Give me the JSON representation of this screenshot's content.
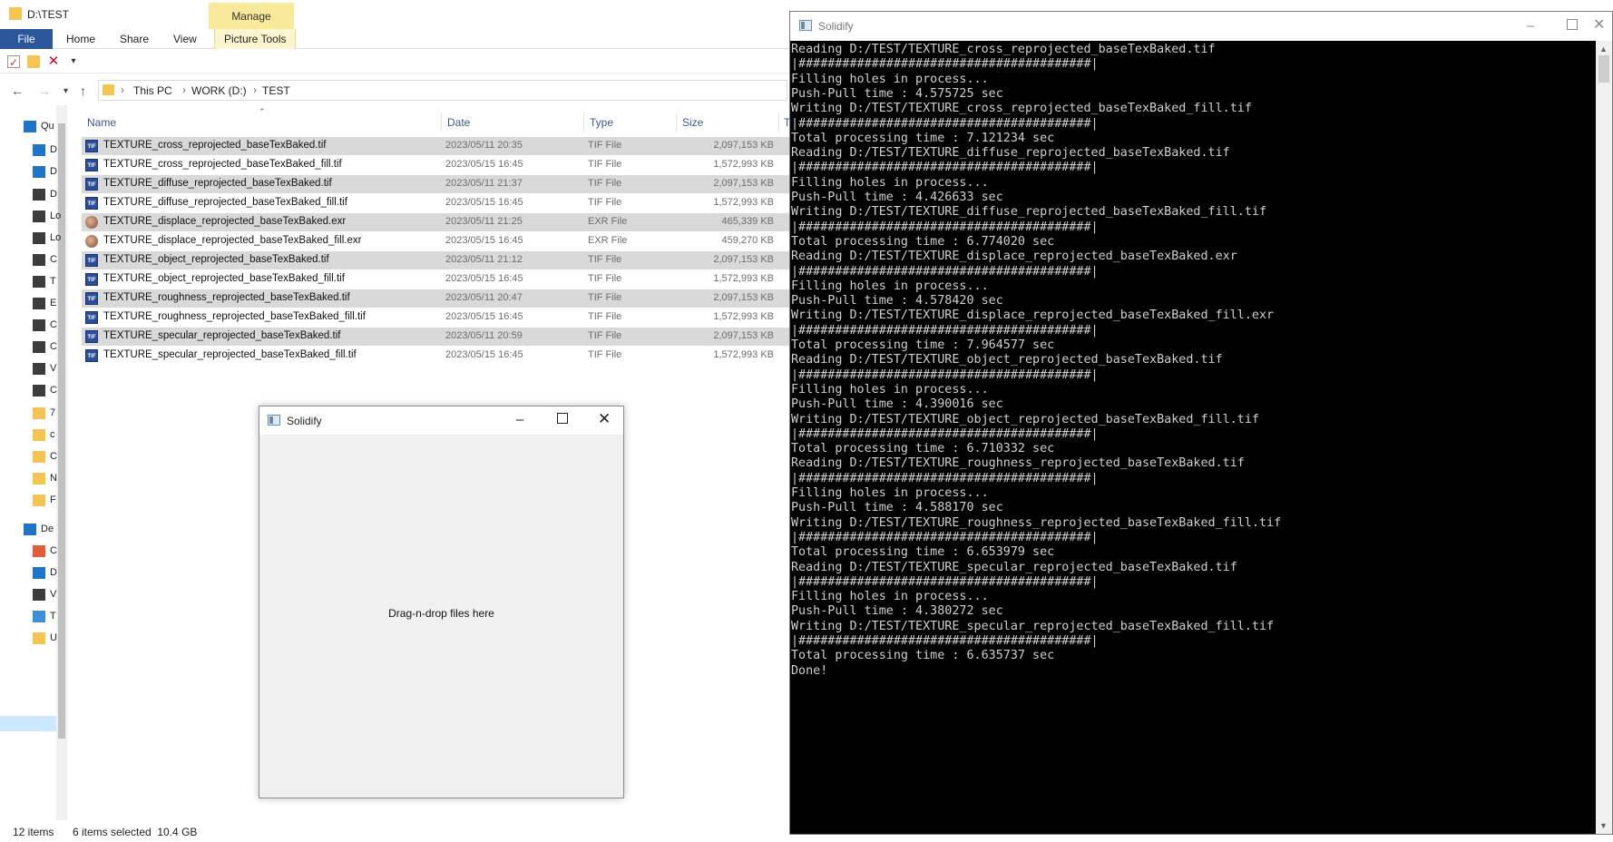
{
  "explorer": {
    "title": "D:\\TEST",
    "ribbon": {
      "contextual_group": "Manage",
      "tabs": [
        "File",
        "Home",
        "Share",
        "View",
        "Picture Tools"
      ]
    },
    "address": {
      "crumbs": [
        "This PC",
        "WORK (D:)",
        "TEST"
      ]
    },
    "sidebar_labels": [
      "Qu",
      "D",
      "D",
      "D",
      "Lo",
      "Lo",
      "C",
      "T",
      "E",
      "C",
      "C",
      "V",
      "C",
      "7",
      "c",
      "C",
      "N",
      "F",
      "De",
      "C",
      "D",
      "V",
      "T",
      "U"
    ],
    "columns": {
      "name": "Name",
      "date": "Date",
      "type": "Type",
      "size": "Size",
      "tags": "T"
    },
    "files": [
      {
        "name": "TEXTURE_cross_reprojected_baseTexBaked.tif",
        "date": "2023/05/11 20:35",
        "type": "TIF File",
        "size": "2,097,153 KB",
        "kind": "tif",
        "selected": true
      },
      {
        "name": "TEXTURE_cross_reprojected_baseTexBaked_fill.tif",
        "date": "2023/05/15 16:45",
        "type": "TIF File",
        "size": "1,572,993 KB",
        "kind": "tif",
        "selected": false
      },
      {
        "name": "TEXTURE_diffuse_reprojected_baseTexBaked.tif",
        "date": "2023/05/11 21:37",
        "type": "TIF File",
        "size": "2,097,153 KB",
        "kind": "tif",
        "selected": true
      },
      {
        "name": "TEXTURE_diffuse_reprojected_baseTexBaked_fill.tif",
        "date": "2023/05/15 16:45",
        "type": "TIF File",
        "size": "1,572,993 KB",
        "kind": "tif",
        "selected": false
      },
      {
        "name": "TEXTURE_displace_reprojected_baseTexBaked.exr",
        "date": "2023/05/11 21:25",
        "type": "EXR File",
        "size": "465,339 KB",
        "kind": "exr",
        "selected": true
      },
      {
        "name": "TEXTURE_displace_reprojected_baseTexBaked_fill.exr",
        "date": "2023/05/15 16:45",
        "type": "EXR File",
        "size": "459,270 KB",
        "kind": "exr",
        "selected": false
      },
      {
        "name": "TEXTURE_object_reprojected_baseTexBaked.tif",
        "date": "2023/05/11 21:12",
        "type": "TIF File",
        "size": "2,097,153 KB",
        "kind": "tif",
        "selected": true
      },
      {
        "name": "TEXTURE_object_reprojected_baseTexBaked_fill.tif",
        "date": "2023/05/15 16:45",
        "type": "TIF File",
        "size": "1,572,993 KB",
        "kind": "tif",
        "selected": false
      },
      {
        "name": "TEXTURE_roughness_reprojected_baseTexBaked.tif",
        "date": "2023/05/11 20:47",
        "type": "TIF File",
        "size": "2,097,153 KB",
        "kind": "tif",
        "selected": true
      },
      {
        "name": "TEXTURE_roughness_reprojected_baseTexBaked_fill.tif",
        "date": "2023/05/15 16:45",
        "type": "TIF File",
        "size": "1,572,993 KB",
        "kind": "tif",
        "selected": false
      },
      {
        "name": "TEXTURE_specular_reprojected_baseTexBaked.tif",
        "date": "2023/05/11 20:59",
        "type": "TIF File",
        "size": "2,097,153 KB",
        "kind": "tif",
        "selected": true
      },
      {
        "name": "TEXTURE_specular_reprojected_baseTexBaked_fill.tif",
        "date": "2023/05/15 16:45",
        "type": "TIF File",
        "size": "1,572,993 KB",
        "kind": "tif",
        "selected": false
      }
    ],
    "status": {
      "items": "12 items",
      "selected": "6 items selected  10.4 GB"
    }
  },
  "drop_window": {
    "title": "Solidify",
    "drop_text": "Drag-n-drop files here"
  },
  "console": {
    "title": "Solidify",
    "lines": [
      "Reading D:/TEST/TEXTURE_cross_reprojected_baseTexBaked.tif",
      "|########################################|",
      "Filling holes in process...",
      "Push-Pull time : 4.575725 sec",
      "Writing D:/TEST/TEXTURE_cross_reprojected_baseTexBaked_fill.tif",
      "|########################################|",
      "Total processing time : 7.121234 sec",
      "Reading D:/TEST/TEXTURE_diffuse_reprojected_baseTexBaked.tif",
      "|########################################|",
      "Filling holes in process...",
      "Push-Pull time : 4.426633 sec",
      "Writing D:/TEST/TEXTURE_diffuse_reprojected_baseTexBaked_fill.tif",
      "|########################################|",
      "Total processing time : 6.774020 sec",
      "Reading D:/TEST/TEXTURE_displace_reprojected_baseTexBaked.exr",
      "|########################################|",
      "Filling holes in process...",
      "Push-Pull time : 4.578420 sec",
      "Writing D:/TEST/TEXTURE_displace_reprojected_baseTexBaked_fill.exr",
      "|########################################|",
      "Total processing time : 7.964577 sec",
      "Reading D:/TEST/TEXTURE_object_reprojected_baseTexBaked.tif",
      "|########################################|",
      "Filling holes in process...",
      "Push-Pull time : 4.390016 sec",
      "Writing D:/TEST/TEXTURE_object_reprojected_baseTexBaked_fill.tif",
      "|########################################|",
      "Total processing time : 6.710332 sec",
      "Reading D:/TEST/TEXTURE_roughness_reprojected_baseTexBaked.tif",
      "|########################################|",
      "Filling holes in process...",
      "Push-Pull time : 4.588170 sec",
      "Writing D:/TEST/TEXTURE_roughness_reprojected_baseTexBaked_fill.tif",
      "|########################################|",
      "Total processing time : 6.653979 sec",
      "Reading D:/TEST/TEXTURE_specular_reprojected_baseTexBaked.tif",
      "|########################################|",
      "Filling holes in process...",
      "Push-Pull time : 4.380272 sec",
      "Writing D:/TEST/TEXTURE_specular_reprojected_baseTexBaked_fill.tif",
      "|########################################|",
      "Total processing time : 6.635737 sec",
      "Done!"
    ]
  },
  "colors": {
    "file_tab": "#2b579a",
    "manage_band": "#f9e99a",
    "selected_row": "#d9d9d9",
    "console_bg": "#000000",
    "console_text": "#cfcfcf"
  }
}
